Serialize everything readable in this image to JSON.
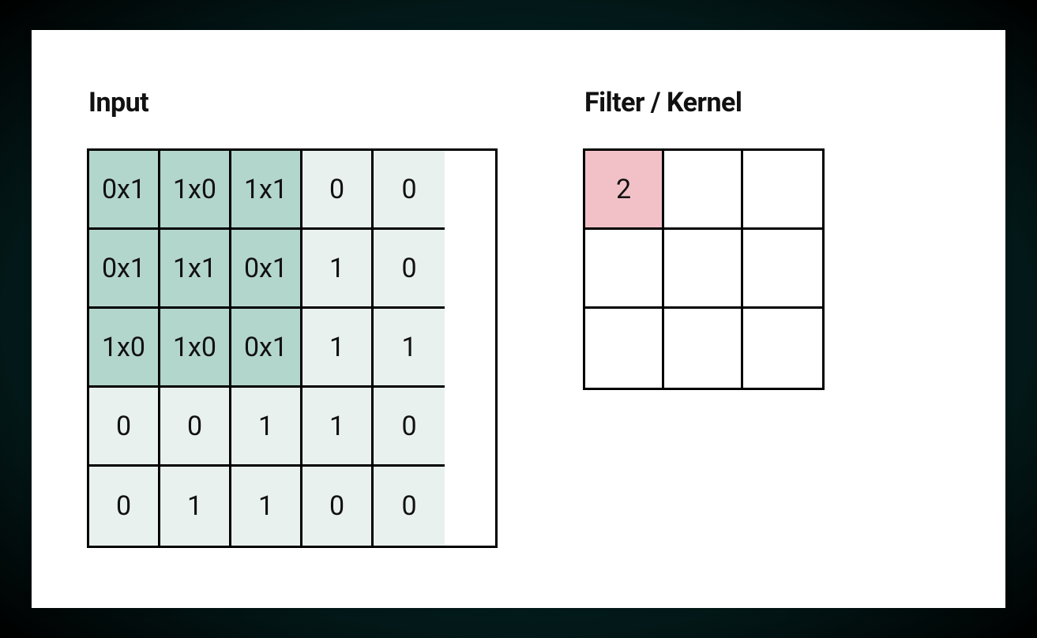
{
  "headings": {
    "input": "Input",
    "filter": "Filter / Kernel"
  },
  "input_grid": {
    "rows": 5,
    "cols": 5,
    "cells": [
      [
        {
          "text": "0x1",
          "highlight": true
        },
        {
          "text": "1x0",
          "highlight": true
        },
        {
          "text": "1x1",
          "highlight": true
        },
        {
          "text": "0",
          "highlight": false
        },
        {
          "text": "0",
          "highlight": false
        }
      ],
      [
        {
          "text": "0x1",
          "highlight": true
        },
        {
          "text": "1x1",
          "highlight": true
        },
        {
          "text": "0x1",
          "highlight": true
        },
        {
          "text": "1",
          "highlight": false
        },
        {
          "text": "0",
          "highlight": false
        }
      ],
      [
        {
          "text": "1x0",
          "highlight": true
        },
        {
          "text": "1x0",
          "highlight": true
        },
        {
          "text": "0x1",
          "highlight": true
        },
        {
          "text": "1",
          "highlight": false
        },
        {
          "text": "1",
          "highlight": false
        }
      ],
      [
        {
          "text": "0",
          "highlight": false
        },
        {
          "text": "0",
          "highlight": false
        },
        {
          "text": "1",
          "highlight": false
        },
        {
          "text": "1",
          "highlight": false
        },
        {
          "text": "0",
          "highlight": false
        }
      ],
      [
        {
          "text": "0",
          "highlight": false
        },
        {
          "text": "1",
          "highlight": false
        },
        {
          "text": "1",
          "highlight": false
        },
        {
          "text": "0",
          "highlight": false
        },
        {
          "text": "0",
          "highlight": false
        }
      ]
    ]
  },
  "filter_grid": {
    "rows": 3,
    "cols": 3,
    "cells": [
      [
        {
          "text": "2",
          "highlight": true
        },
        {
          "text": "",
          "highlight": false
        },
        {
          "text": "",
          "highlight": false
        }
      ],
      [
        {
          "text": "",
          "highlight": false
        },
        {
          "text": "",
          "highlight": false
        },
        {
          "text": "",
          "highlight": false
        }
      ],
      [
        {
          "text": "",
          "highlight": false
        },
        {
          "text": "",
          "highlight": false
        },
        {
          "text": "",
          "highlight": false
        }
      ]
    ]
  },
  "colors": {
    "input_cell_bg": "#e9f1ef",
    "input_highlight_bg": "#b3d6cc",
    "filter_cell_bg": "#ffffff",
    "filter_highlight_bg": "#f1c1c7"
  }
}
